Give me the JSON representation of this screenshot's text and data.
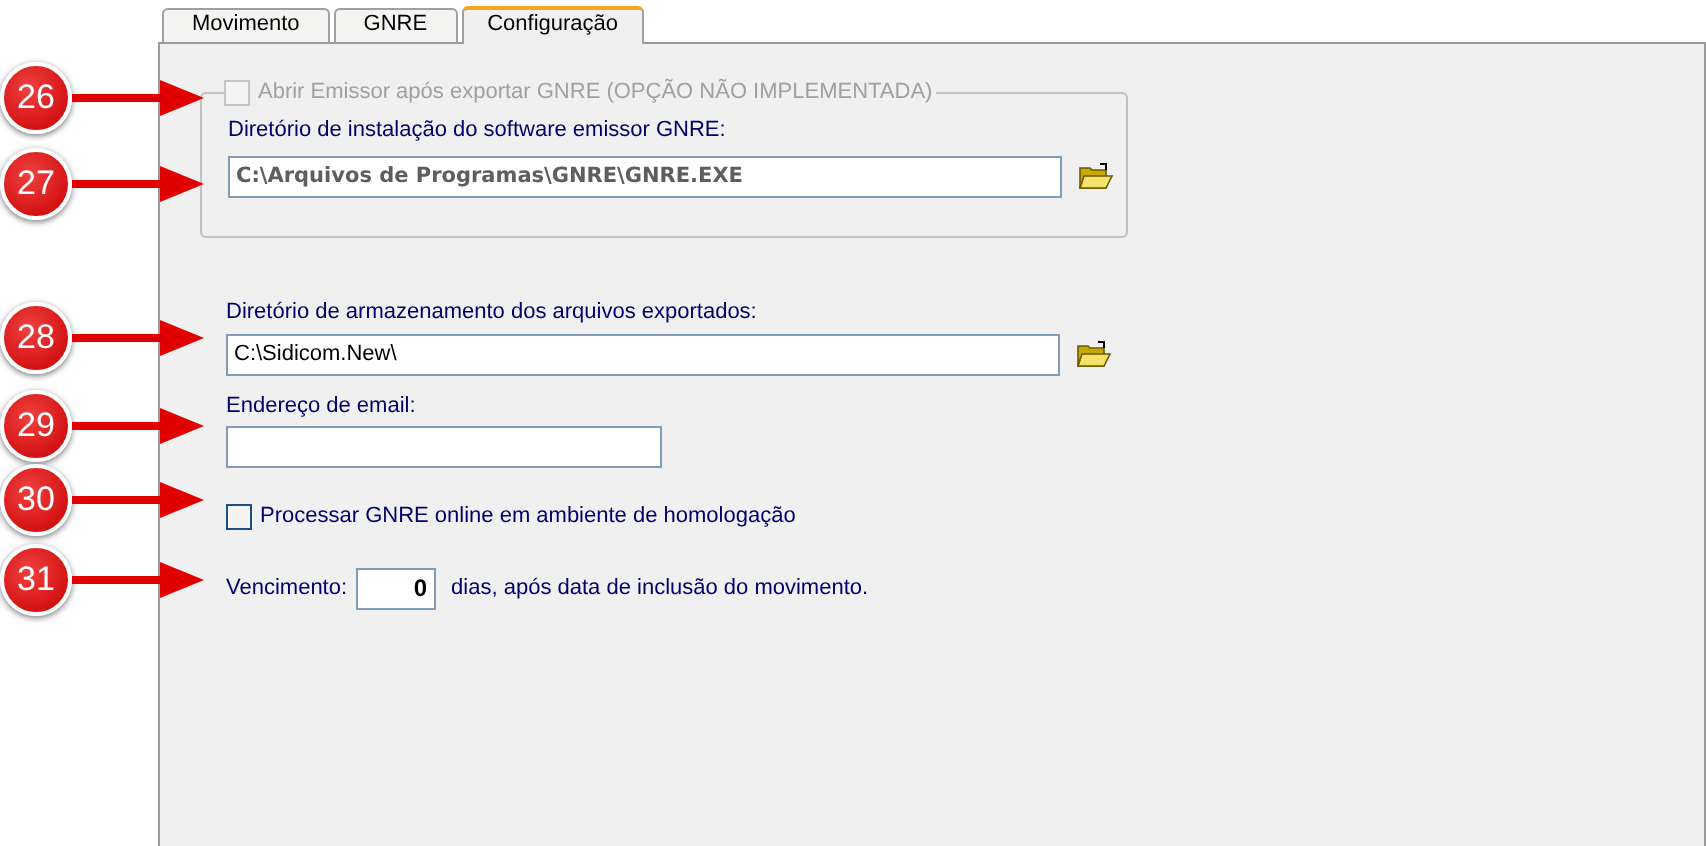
{
  "tabs": [
    {
      "label": "Movimento",
      "selected": false
    },
    {
      "label": "GNRE",
      "selected": false
    },
    {
      "label": "Configuração",
      "selected": true
    }
  ],
  "open_emitter": {
    "label": "Abrir Emissor após exportar GNRE (OPÇÃO NÃO IMPLEMENTADA)",
    "checked": false,
    "disabled": true
  },
  "install_dir": {
    "label": "Diretório de instalação do software emissor GNRE:",
    "value": "C:\\Arquivos de Programas\\GNRE\\GNRE.EXE",
    "disabled": true
  },
  "export_dir": {
    "label": "Diretório de armazenamento dos arquivos exportados:",
    "value": "C:\\Sidicom.New\\",
    "disabled": false
  },
  "email": {
    "label": "Endereço de email:"
  },
  "homologation": {
    "label": "Processar GNRE online em ambiente de homologação",
    "checked": false,
    "disabled": false
  },
  "due": {
    "label": "Vencimento:",
    "value": "0",
    "suffix": "dias, após data de inclusão do movimento."
  },
  "callouts": [
    "26",
    "27",
    "28",
    "29",
    "30",
    "31"
  ]
}
